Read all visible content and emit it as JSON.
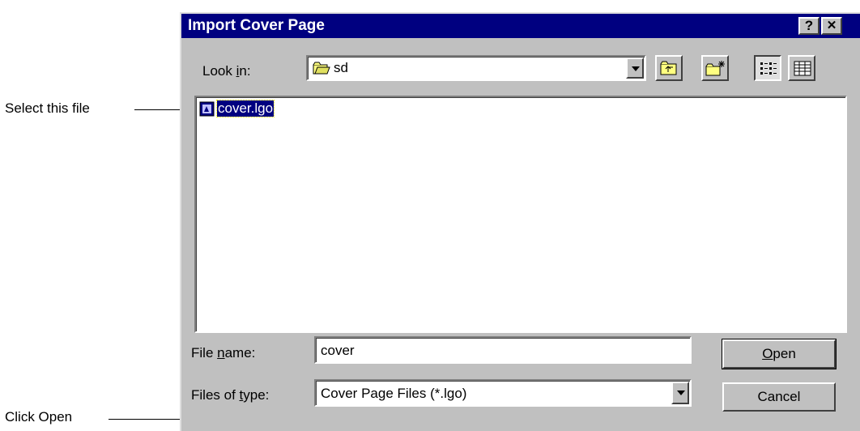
{
  "callouts": {
    "select_file": "Select this file",
    "click_open": "Click Open"
  },
  "dialog": {
    "title": "Import Cover Page",
    "help_button": "?",
    "close_button": "✕",
    "look_in": {
      "label_pre": "Look ",
      "label_accel": "i",
      "label_post": "n:",
      "value": "sd"
    },
    "files": [
      {
        "name": "cover.lgo",
        "selected": true
      }
    ],
    "file_name": {
      "label_pre": "File ",
      "label_accel": "n",
      "label_post": "ame:",
      "value": "cover"
    },
    "file_type": {
      "label_pre": "Files of ",
      "label_accel": "t",
      "label_post": "ype:",
      "value": "Cover Page Files (*.lgo)"
    },
    "open_button": {
      "accel": "O",
      "rest": "pen"
    },
    "cancel_button": "Cancel"
  },
  "colors": {
    "titlebar": "#000080",
    "face": "#c0c0c0",
    "selection": "#000080"
  }
}
